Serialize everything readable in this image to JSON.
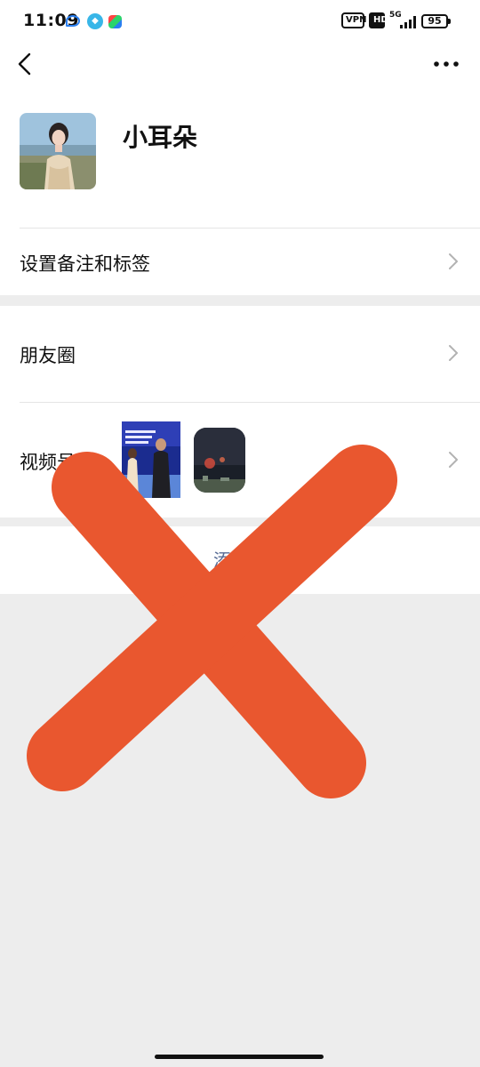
{
  "status_bar": {
    "time": "11:09",
    "vpn_label": "VPN",
    "hd_label": "HD",
    "network_label": "5G",
    "battery_level": "95"
  },
  "profile": {
    "nickname": "小耳朵"
  },
  "rows": {
    "remark_tags": "设置备注和标签",
    "moments": "朋友圈",
    "channels": "视频号"
  },
  "add_button": {
    "label": "添加至"
  },
  "colors": {
    "background": "#ededed",
    "cross_overlay": "#e9572f",
    "link_blue": "#576b95"
  },
  "icons": {
    "back": "back-chevron-icon",
    "more": "more-dots-icon",
    "row_arrow": "chevron-right-icon"
  }
}
